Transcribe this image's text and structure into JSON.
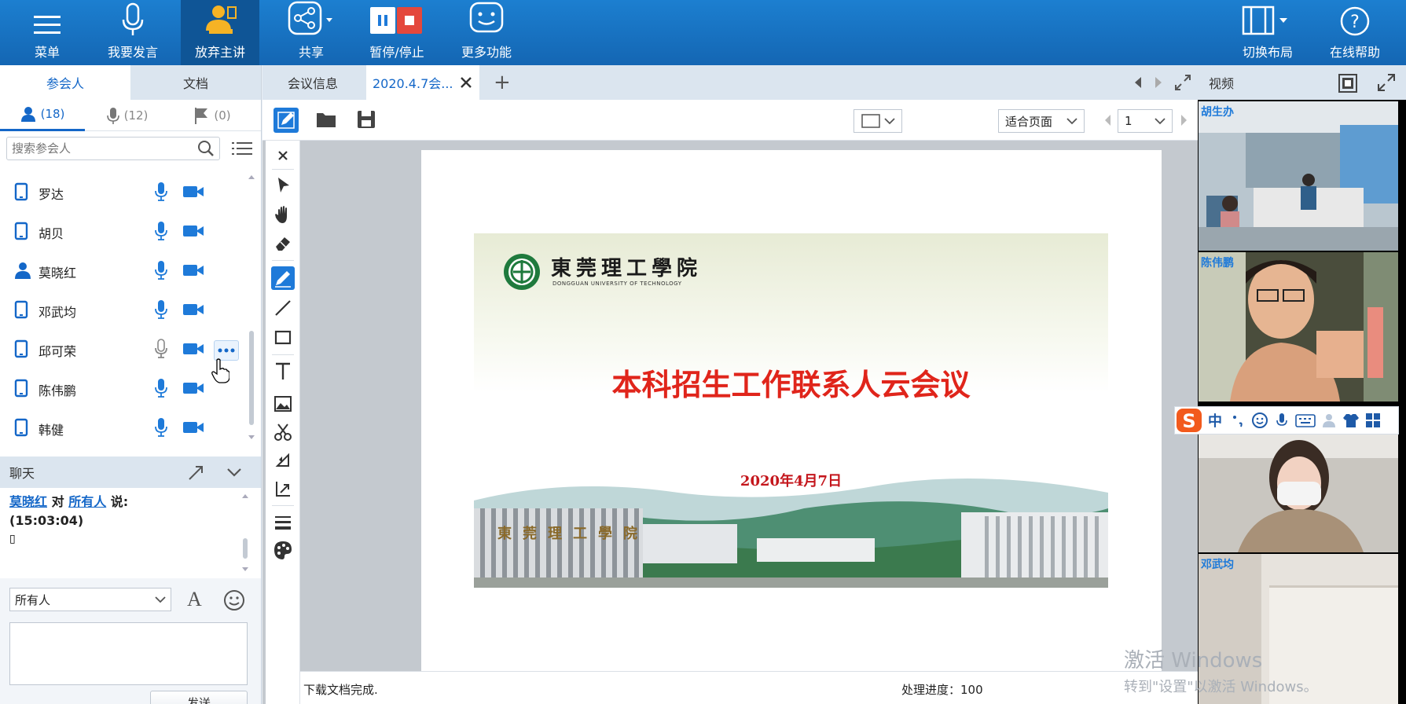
{
  "toolbar": {
    "menu": "菜单",
    "speak": "我要发言",
    "give_up_presenter": "放弃主讲",
    "share": "共享",
    "pause_stop": "暂停/停止",
    "more_functions": "更多功能",
    "switch_layout": "切换布局",
    "online_help": "在线帮助"
  },
  "left_tabs": {
    "participants": "参会人",
    "documents": "文档"
  },
  "counts": {
    "people": "(18)",
    "mic": "(12)",
    "flag": "(0)"
  },
  "search": {
    "placeholder": "搜索参会人"
  },
  "participants": [
    {
      "name": "罗达",
      "device": "tablet"
    },
    {
      "name": "胡贝",
      "device": "tablet"
    },
    {
      "name": "莫晓红",
      "device": "user"
    },
    {
      "name": "邓武均",
      "device": "tablet"
    },
    {
      "name": "邱可荣",
      "device": "tablet"
    },
    {
      "name": "陈伟鹏",
      "device": "tablet"
    },
    {
      "name": "韩健",
      "device": "tablet"
    }
  ],
  "chat": {
    "title": "聊天",
    "sender": "莫晓红",
    "to_word": "对",
    "receiver": "所有人",
    "says": "说:",
    "time": "(15:03:04)",
    "message": "▯",
    "target": "所有人",
    "send_label": "发送"
  },
  "doc_tabs": {
    "meeting_info": "会议信息",
    "file": "2020.4.7会...",
    "add": "+"
  },
  "doc_toolbar": {
    "fit": "适合页面",
    "page": "1"
  },
  "slide": {
    "school_cn": "東莞理工學院",
    "school_en": "DONGGUAN UNIVERSITY OF TECHNOLOGY",
    "title": "本科招生工作联系人云会议",
    "date": "2020年4月7日",
    "campus_sign": "東莞理工學院"
  },
  "status": {
    "left": "下载文档完成.",
    "progress_label": "处理进度：",
    "progress_value": "100"
  },
  "video_panel": {
    "title": "视频",
    "feeds": [
      {
        "label": "胡生办"
      },
      {
        "label": "陈伟鹏"
      },
      {
        "label": ""
      },
      {
        "label": "邓武均"
      }
    ]
  },
  "ime": {
    "mode": "中"
  },
  "watermark": {
    "line1": "激活 Windows",
    "line2": "转到\"设置\"以激活 Windows。"
  },
  "colors": {
    "toolbar": "#1466b3",
    "accent": "#1e7ad9",
    "title_red": "#e0251b"
  }
}
